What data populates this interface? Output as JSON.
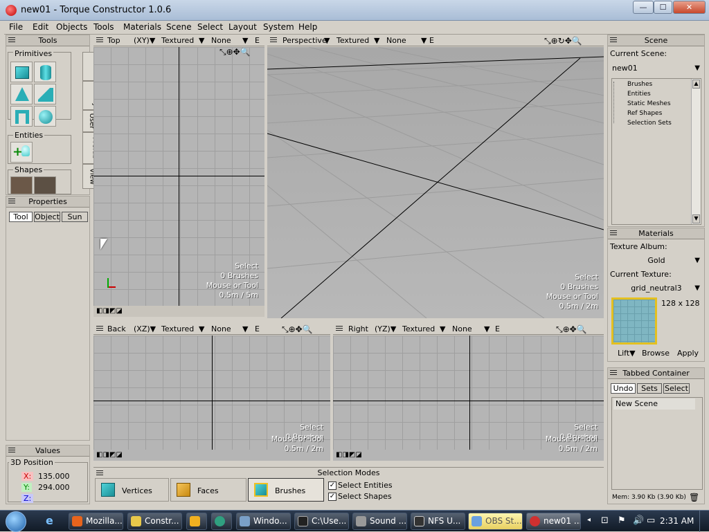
{
  "window": {
    "title": "new01 - Torque Constructor 1.0.6",
    "minimize": "—",
    "maximize": "☐",
    "close": "✕"
  },
  "menu": [
    "File",
    "Edit",
    "Objects",
    "Tools",
    "Materials",
    "Scene",
    "Select",
    "Layout",
    "System",
    "Help"
  ],
  "tools_panel": {
    "title": "Tools",
    "primitives_label": "Primitives",
    "entities_label": "Entities",
    "shapes_label": "Shapes",
    "tabs": [
      "Create",
      "Modify",
      "User",
      "Prefab",
      "View"
    ]
  },
  "properties_panel": {
    "title": "Properties",
    "tabs": [
      "Tool",
      "Object",
      "Sun"
    ]
  },
  "values_panel": {
    "title": "Values",
    "position_label": "3D Position",
    "x_label": "X:",
    "x_value": "135.000",
    "y_label": "Y:",
    "y_value": "294.000",
    "z_label": "Z:",
    "z_value": ""
  },
  "viewports": {
    "top": {
      "name": "Top",
      "axes": "(XY)▼",
      "mode": "Textured",
      "mode2": "None",
      "e": "E",
      "info": [
        "Select",
        "0 Brushes",
        "Mouse or Tool",
        "0.5m / 5m"
      ]
    },
    "perspective": {
      "name": "Perspective",
      "mode": "Textured",
      "mode2": "None",
      "e": "E",
      "info": [
        "Select",
        "0 Brushes",
        "Mouse or Tool",
        "0.5m / 2m"
      ]
    },
    "back": {
      "name": "Back",
      "axes": "(XZ)▼",
      "mode": "Textured",
      "mode2": "None",
      "e": "E",
      "info": [
        "Select",
        "0 Brushes",
        "Mouse or Tool",
        "0.5m / 2m"
      ]
    },
    "right": {
      "name": "Right",
      "axes": "(YZ)▼",
      "mode": "Textured",
      "mode2": "None",
      "e": "E",
      "info": [
        "Select",
        "0 Brushes",
        "Mouse or Tool",
        "0.5m / 2m"
      ]
    }
  },
  "selection_modes": {
    "title": "Selection Modes",
    "vertices": "Vertices",
    "faces": "Faces",
    "brushes": "Brushes",
    "select_entities": "Select Entities",
    "select_shapes": "Select Shapes"
  },
  "scene_panel": {
    "title": "Scene",
    "current_scene_label": "Current Scene:",
    "current_scene": "new01",
    "tree": [
      "Brushes",
      "Entities",
      "Static Meshes",
      "Ref Shapes",
      "Selection Sets"
    ]
  },
  "materials_panel": {
    "title": "Materials",
    "album_label": "Texture Album:",
    "album": "Gold",
    "texture_label": "Current Texture:",
    "texture": "grid_neutral3",
    "size": "128 x 128",
    "lift": "Lift▼",
    "browse": "Browse",
    "apply": "Apply"
  },
  "tabbed_container": {
    "title": "Tabbed Container",
    "tabs": [
      "Undo",
      "Sets",
      "Select"
    ],
    "items": [
      "New Scene"
    ],
    "memory": "Mem: 3.90 Kb (3.90 Kb)"
  },
  "taskbar": {
    "items": [
      "Mozilla...",
      "Constr...",
      "",
      "",
      "Windo...",
      "C:\\Use...",
      "Sound ...",
      "NFS U...",
      "OBS St...",
      "new01 ..."
    ],
    "clock": "2:31 AM"
  }
}
